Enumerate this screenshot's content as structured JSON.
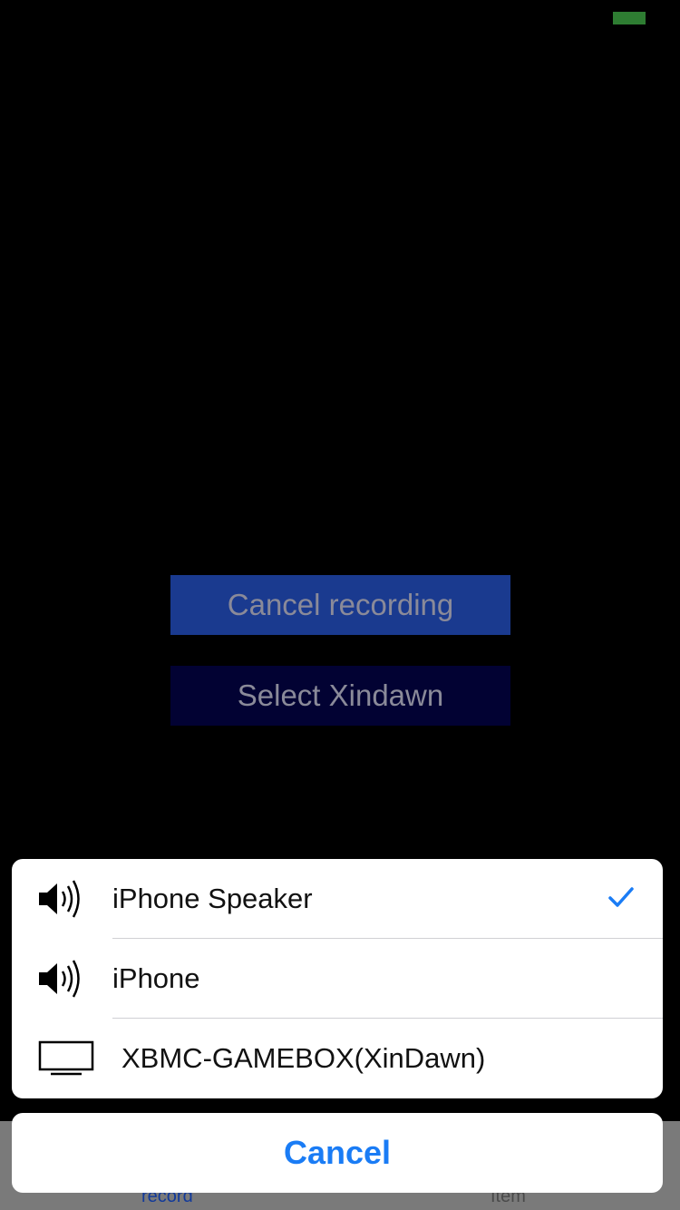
{
  "status": {
    "indicator_color": "#2e7d32"
  },
  "main": {
    "cancel_recording_label": "Cancel recording",
    "select_label": "Select Xindawn"
  },
  "tabbar": {
    "tabs": [
      {
        "label": "record",
        "active": true
      },
      {
        "label": "Item",
        "active": false
      }
    ]
  },
  "route_sheet": {
    "items": [
      {
        "icon": "speaker-icon",
        "label": "iPhone Speaker",
        "selected": true
      },
      {
        "icon": "speaker-icon",
        "label": "iPhone",
        "selected": false
      },
      {
        "icon": "tv-icon",
        "label": "XBMC-GAMEBOX(XinDawn)",
        "selected": false
      }
    ],
    "cancel_label": "Cancel",
    "accent_color": "#1a7cf5"
  }
}
